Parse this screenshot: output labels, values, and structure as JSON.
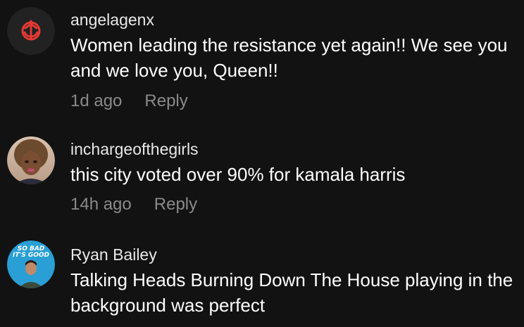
{
  "comments": [
    {
      "username": "angelagenx",
      "text": "Women leading the resistance yet again!! We see you and we love you, Queen!!",
      "time": "1d ago",
      "reply_label": "Reply"
    },
    {
      "username": "inchargeofthegirls",
      "text": "this city voted over 90% for kamala harris",
      "time": "14h ago",
      "reply_label": "Reply"
    },
    {
      "username": "Ryan Bailey",
      "text": "Talking Heads Burning Down The House playing in the background was perfect",
      "avatar_text": "SO BAD IT'S GOOD"
    }
  ],
  "colors": {
    "background": "#121212",
    "username": "#e8e8e8",
    "text": "#ffffff",
    "meta": "#8a8a8a",
    "avatar1_bg": "#222222",
    "avatar1_emblem": "#e53935",
    "avatar3_bg": "#2a9fd6"
  },
  "icons": {
    "avatar1": "rebel-alliance-emblem",
    "avatar2": "profile-photo",
    "avatar3": "podcast-logo"
  }
}
